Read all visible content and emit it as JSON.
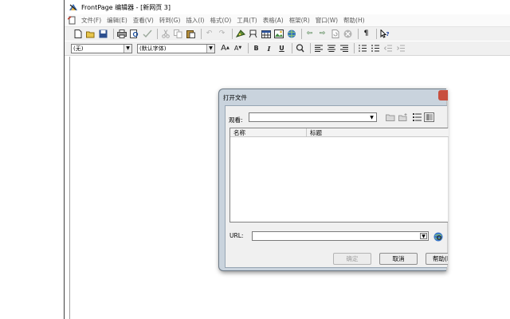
{
  "window": {
    "title": "FrontPage 编辑器 - [新网页 3]"
  },
  "menu": [
    {
      "id": "file",
      "label": "文件(F)"
    },
    {
      "id": "edit",
      "label": "编辑(E)"
    },
    {
      "id": "view",
      "label": "查看(V)"
    },
    {
      "id": "goto",
      "label": "转到(G)"
    },
    {
      "id": "insert",
      "label": "插入(I)"
    },
    {
      "id": "format",
      "label": "格式(O)"
    },
    {
      "id": "tools",
      "label": "工具(T)"
    },
    {
      "id": "table",
      "label": "表格(A)"
    },
    {
      "id": "frame",
      "label": "框架(R)"
    },
    {
      "id": "window",
      "label": "窗口(W)"
    },
    {
      "id": "help",
      "label": "帮助(H)"
    }
  ],
  "format_bar": {
    "style_value": "(无)",
    "font_value": "(默认字体)",
    "bold": "B",
    "italic": "I",
    "underline": "U",
    "increase_font": "A",
    "decrease_font": "A"
  },
  "toolbar_icons": [
    "new-icon",
    "open-icon",
    "save-icon",
    "print-icon",
    "print-preview-icon",
    "spell-check-icon",
    "cut-icon",
    "copy-icon",
    "paste-icon",
    "undo-icon",
    "redo-icon",
    "webbot-icon",
    "insert-bot-icon",
    "insert-table-icon",
    "insert-image-icon",
    "insert-link-icon",
    "back-icon",
    "forward-icon",
    "refresh-icon",
    "stop-icon",
    "show-marks-icon",
    "help-cursor-icon"
  ],
  "dialog": {
    "title": "打开文件",
    "look_in_label": "观看:",
    "look_in_value": "",
    "columns": [
      "名称",
      "标题"
    ],
    "url_label": "URL:",
    "url_value": "",
    "ok_label": "确定",
    "cancel_label": "取消",
    "help_label": "帮助(H)"
  },
  "colors": {
    "dialog_frame": "#c9d3dd",
    "close_button": "#c84f3e",
    "menu_text": "#5a5a5a"
  }
}
